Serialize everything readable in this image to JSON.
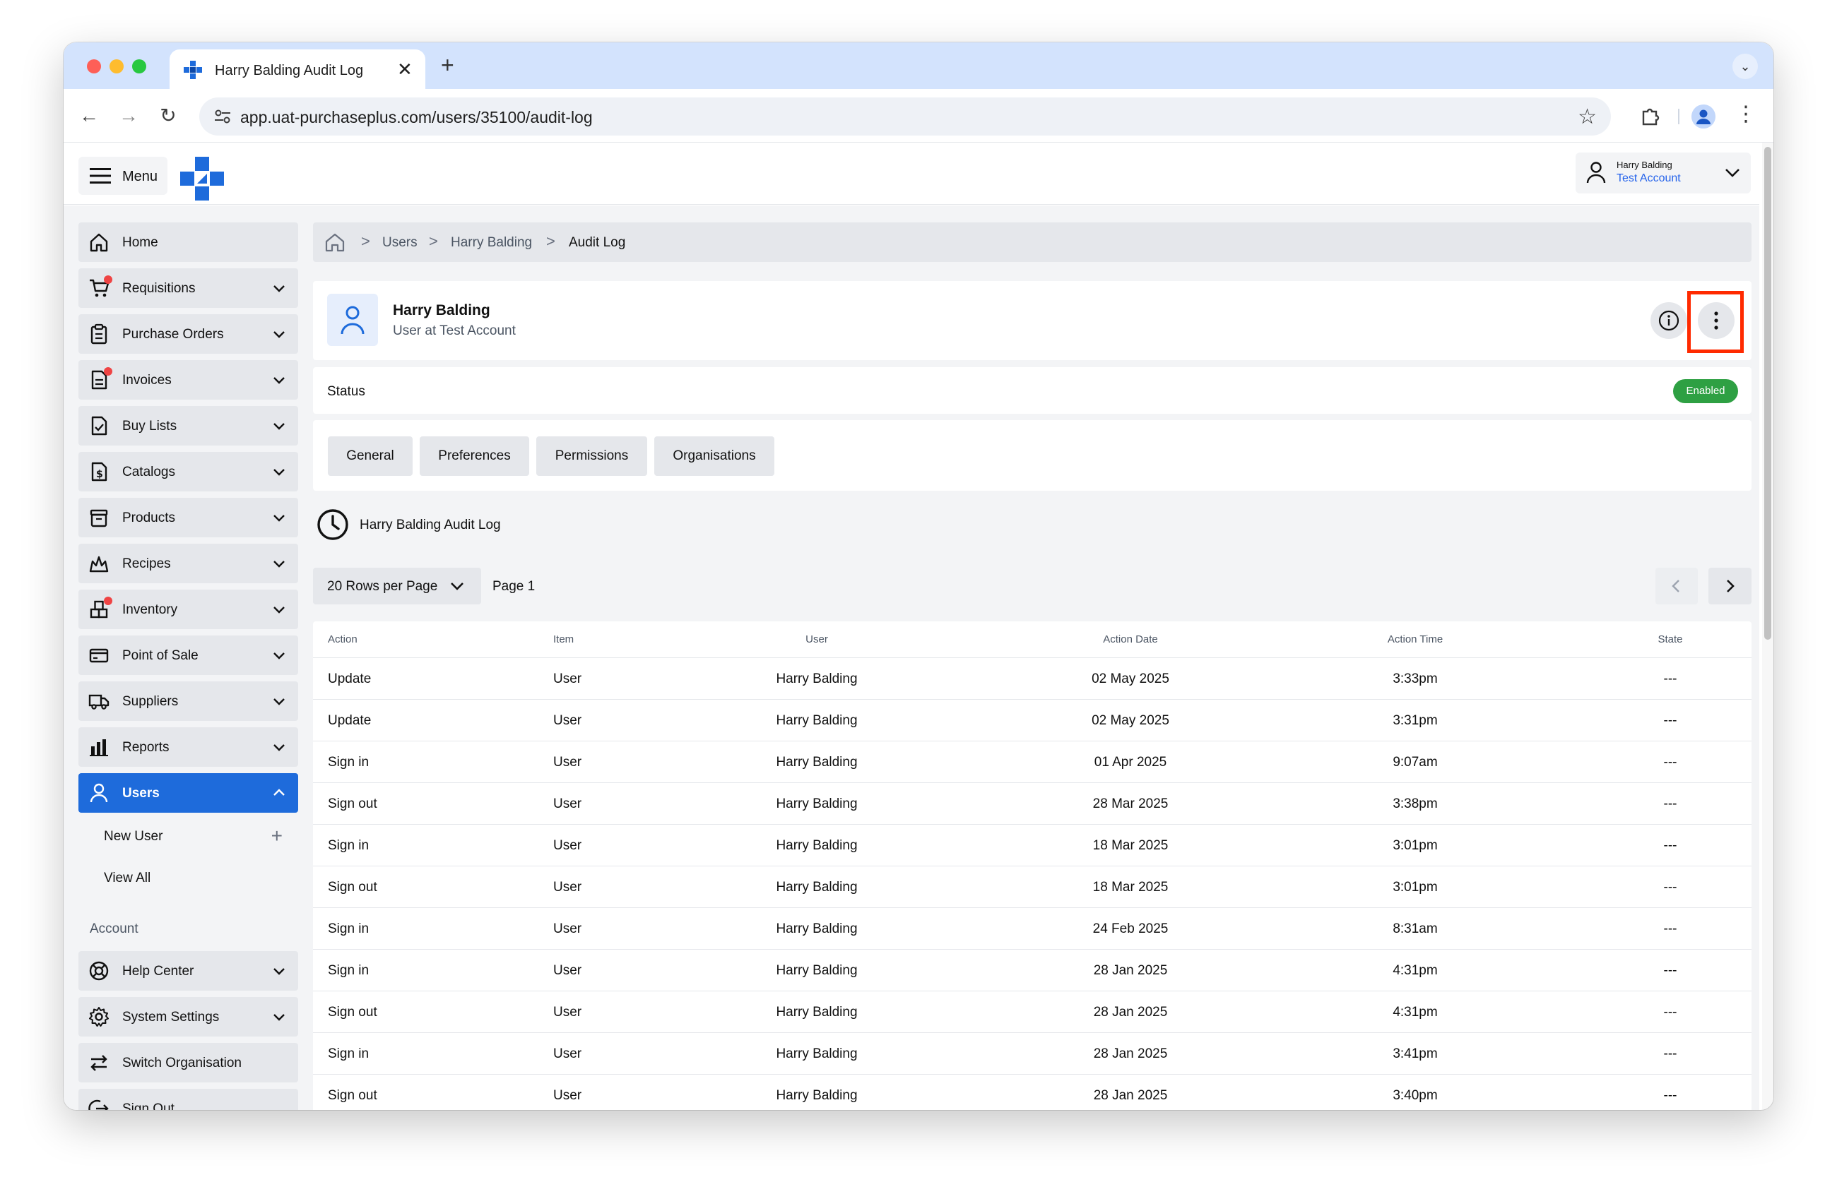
{
  "browser": {
    "tab_title": "Harry Balding Audit Log",
    "tab_close": "✕",
    "new_tab": "+",
    "url": "app.uat-purchaseplus.com/users/35100/audit-log"
  },
  "header": {
    "menu_label": "Menu",
    "user_name": "Harry Balding",
    "user_account": "Test Account"
  },
  "sidebar": {
    "items": [
      {
        "label": "Home",
        "icon": "home-icon",
        "chevron": false,
        "dot": false
      },
      {
        "label": "Requisitions",
        "icon": "cart-icon",
        "chevron": true,
        "dot": true
      },
      {
        "label": "Purchase Orders",
        "icon": "clipboard-icon",
        "chevron": true,
        "dot": false
      },
      {
        "label": "Invoices",
        "icon": "invoice-icon",
        "chevron": true,
        "dot": true
      },
      {
        "label": "Buy Lists",
        "icon": "checklist-icon",
        "chevron": true,
        "dot": false
      },
      {
        "label": "Catalogs",
        "icon": "dollar-doc-icon",
        "chevron": true,
        "dot": false
      },
      {
        "label": "Products",
        "icon": "box-icon",
        "chevron": true,
        "dot": false
      },
      {
        "label": "Recipes",
        "icon": "chef-icon",
        "chevron": true,
        "dot": false
      },
      {
        "label": "Inventory",
        "icon": "boxes-icon",
        "chevron": true,
        "dot": true
      },
      {
        "label": "Point of Sale",
        "icon": "card-icon",
        "chevron": true,
        "dot": false
      },
      {
        "label": "Suppliers",
        "icon": "truck-icon",
        "chevron": true,
        "dot": false
      },
      {
        "label": "Reports",
        "icon": "bar-chart-icon",
        "chevron": true,
        "dot": false
      },
      {
        "label": "Users",
        "icon": "user-icon",
        "chevron": true,
        "dot": false,
        "active": true
      }
    ],
    "sub_items": [
      {
        "label": "New User",
        "plus": "+"
      },
      {
        "label": "View All"
      }
    ],
    "account_section_label": "Account",
    "account_items": [
      {
        "label": "Help Center",
        "icon": "lifebuoy-icon",
        "chevron": true
      },
      {
        "label": "System Settings",
        "icon": "settings-gear-icon",
        "chevron": true
      },
      {
        "label": "Switch Organisation",
        "icon": "switch-arrows-icon",
        "chevron": false
      },
      {
        "label": "Sign Out",
        "icon": "sign-out-icon",
        "chevron": false
      }
    ]
  },
  "breadcrumb": {
    "items": [
      "Users",
      "Harry Balding",
      "Audit Log"
    ],
    "separator": ">"
  },
  "user_card": {
    "name": "Harry Balding",
    "subtitle": "User at Test Account"
  },
  "status": {
    "label": "Status",
    "badge": "Enabled"
  },
  "tabs": [
    "General",
    "Preferences",
    "Permissions",
    "Organisations"
  ],
  "audit_log": {
    "title": "Harry Balding Audit Log",
    "rows_per_page": "20 Rows per Page",
    "page_label": "Page 1",
    "columns": [
      "Action",
      "Item",
      "User",
      "Action Date",
      "Action Time",
      "State"
    ],
    "rows": [
      {
        "action": "Update",
        "item": "User",
        "user": "Harry Balding",
        "date": "02 May 2025",
        "time": "3:33pm",
        "state": "---"
      },
      {
        "action": "Update",
        "item": "User",
        "user": "Harry Balding",
        "date": "02 May 2025",
        "time": "3:31pm",
        "state": "---"
      },
      {
        "action": "Sign in",
        "item": "User",
        "user": "Harry Balding",
        "date": "01 Apr 2025",
        "time": "9:07am",
        "state": "---"
      },
      {
        "action": "Sign out",
        "item": "User",
        "user": "Harry Balding",
        "date": "28 Mar 2025",
        "time": "3:38pm",
        "state": "---"
      },
      {
        "action": "Sign in",
        "item": "User",
        "user": "Harry Balding",
        "date": "18 Mar 2025",
        "time": "3:01pm",
        "state": "---"
      },
      {
        "action": "Sign out",
        "item": "User",
        "user": "Harry Balding",
        "date": "18 Mar 2025",
        "time": "3:01pm",
        "state": "---"
      },
      {
        "action": "Sign in",
        "item": "User",
        "user": "Harry Balding",
        "date": "24 Feb 2025",
        "time": "8:31am",
        "state": "---"
      },
      {
        "action": "Sign in",
        "item": "User",
        "user": "Harry Balding",
        "date": "28 Jan 2025",
        "time": "4:31pm",
        "state": "---"
      },
      {
        "action": "Sign out",
        "item": "User",
        "user": "Harry Balding",
        "date": "28 Jan 2025",
        "time": "4:31pm",
        "state": "---"
      },
      {
        "action": "Sign in",
        "item": "User",
        "user": "Harry Balding",
        "date": "28 Jan 2025",
        "time": "3:41pm",
        "state": "---"
      },
      {
        "action": "Sign out",
        "item": "User",
        "user": "Harry Balding",
        "date": "28 Jan 2025",
        "time": "3:40pm",
        "state": "---"
      }
    ]
  },
  "colors": {
    "brand_blue": "#1e6bdb",
    "enabled_green": "#2ea043",
    "highlight_red": "#ff2a00",
    "notification_red": "#ef4444"
  }
}
